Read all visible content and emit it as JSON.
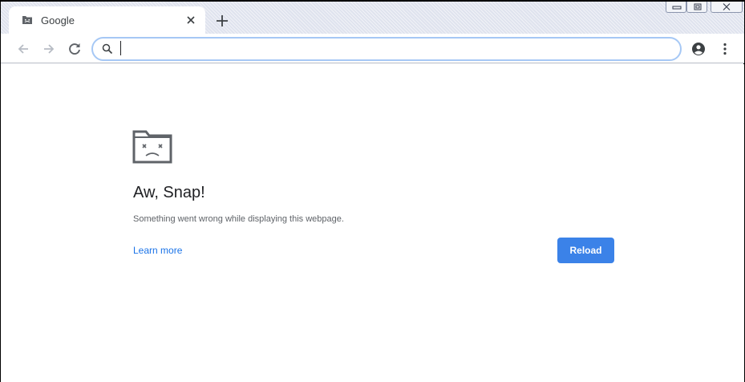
{
  "tab": {
    "title": "Google",
    "favicon": "sad-folder-icon",
    "close_icon": "close-icon"
  },
  "window_controls": [
    "minimize-icon",
    "maximize-icon",
    "close-icon"
  ],
  "toolbar": {
    "back_icon": "arrow-back-icon",
    "forward_icon": "arrow-forward-icon",
    "reload_icon": "reload-icon",
    "profile_icon": "account-circle-icon",
    "menu_icon": "more-vert-icon"
  },
  "omnibox": {
    "value": "",
    "placeholder": ""
  },
  "error_page": {
    "icon": "sad-tab-icon",
    "title": "Aw, Snap!",
    "message": "Something went wrong while displaying this webpage.",
    "learn_more": "Learn more",
    "reload_label": "Reload"
  },
  "colors": {
    "accent": "#3b82e8",
    "link": "#1a73e8",
    "omnibox_border": "#a6c8f5",
    "tabstrip": "#dfe3ee"
  }
}
